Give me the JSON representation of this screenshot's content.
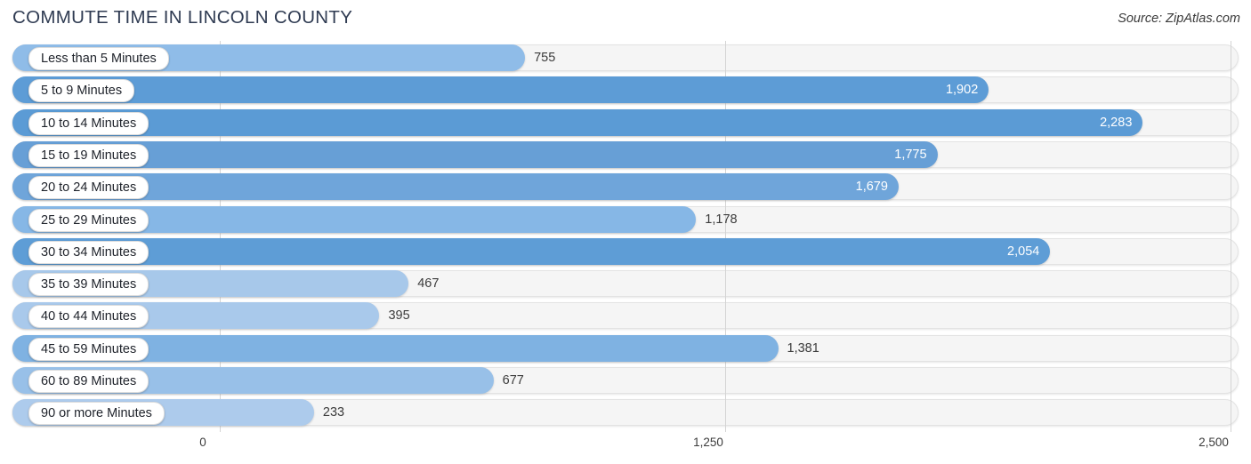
{
  "header": {
    "title": "COMMUTE TIME IN LINCOLN COUNTY",
    "source": "Source: ZipAtlas.com"
  },
  "colors": {
    "bar_dark": "#5b9bd5",
    "bar_light": "#a7c8ea",
    "track": "#f5f5f5",
    "gridline": "#d4d4d4",
    "title_text": "#2f3b52",
    "value_text_inside": "#ffffff",
    "value_text_outside": "#3b3b3b"
  },
  "chart_data": {
    "type": "bar",
    "orientation": "horizontal",
    "title": "COMMUTE TIME IN LINCOLN COUNTY",
    "xlabel": "",
    "ylabel": "",
    "xlim": [
      0,
      2500
    ],
    "grid": true,
    "legend": "none",
    "xticks": [
      {
        "value": 0,
        "label": "0"
      },
      {
        "value": 1250,
        "label": "1,250"
      },
      {
        "value": 2500,
        "label": "2,500"
      }
    ],
    "categories": [
      "Less than 5 Minutes",
      "5 to 9 Minutes",
      "10 to 14 Minutes",
      "15 to 19 Minutes",
      "20 to 24 Minutes",
      "25 to 29 Minutes",
      "30 to 34 Minutes",
      "35 to 39 Minutes",
      "40 to 44 Minutes",
      "45 to 59 Minutes",
      "60 to 89 Minutes",
      "90 or more Minutes"
    ],
    "values": [
      755,
      1902,
      2283,
      1775,
      1679,
      1178,
      2054,
      467,
      395,
      1381,
      677,
      233
    ],
    "value_labels": [
      "755",
      "1,902",
      "2,283",
      "1,775",
      "1,679",
      "1,178",
      "2,054",
      "467",
      "395",
      "1,381",
      "677",
      "233"
    ],
    "label_placement": [
      "outside",
      "inside",
      "inside",
      "inside",
      "inside",
      "outside",
      "inside",
      "outside",
      "outside",
      "outside",
      "outside",
      "outside"
    ],
    "bar_colors": [
      "#8fbce8",
      "#5d9cd6",
      "#5b9bd5",
      "#679fd6",
      "#6fa5da",
      "#86b7e6",
      "#5e9dd6",
      "#a7c8ea",
      "#a9c9eb",
      "#7fb2e2",
      "#98c0e8",
      "#adcbec"
    ]
  }
}
